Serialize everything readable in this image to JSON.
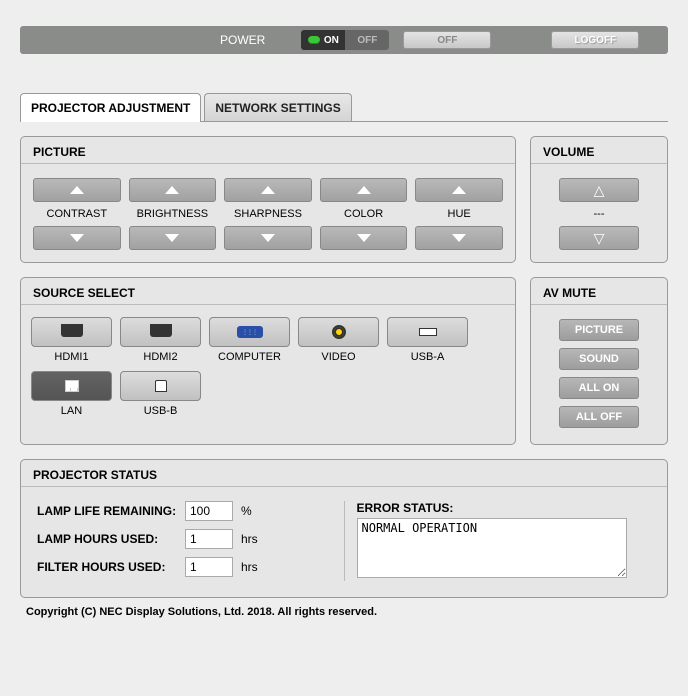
{
  "power_label": "POWER",
  "power": {
    "on": "ON",
    "off": "OFF"
  },
  "off_btn": "OFF",
  "logoff_btn": "LOGOFF",
  "tabs": {
    "adjustment": "PROJECTOR ADJUSTMENT",
    "network": "NETWORK SETTINGS"
  },
  "picture": {
    "title": "PICTURE",
    "items": [
      "CONTRAST",
      "BRIGHTNESS",
      "SHARPNESS",
      "COLOR",
      "HUE"
    ]
  },
  "volume": {
    "title": "VOLUME",
    "value": "---"
  },
  "source": {
    "title": "SOURCE SELECT",
    "items": [
      "HDMI1",
      "HDMI2",
      "COMPUTER",
      "VIDEO",
      "USB-A",
      "LAN",
      "USB-B"
    ],
    "selected": "LAN"
  },
  "avmute": {
    "title": "AV MUTE",
    "buttons": [
      "PICTURE",
      "SOUND",
      "ALL ON",
      "ALL OFF"
    ]
  },
  "status": {
    "title": "PROJECTOR STATUS",
    "lamp_life_label": "LAMP LIFE REMAINING:",
    "lamp_life_value": "100",
    "lamp_life_unit": "%",
    "lamp_hours_label": "LAMP HOURS USED:",
    "lamp_hours_value": "1",
    "lamp_hours_unit": "hrs",
    "filter_hours_label": "FILTER HOURS USED:",
    "filter_hours_value": "1",
    "filter_hours_unit": "hrs",
    "error_label": "ERROR STATUS:",
    "error_value": "NORMAL OPERATION"
  },
  "copyright": "Copyright (C) NEC Display Solutions, Ltd. 2018. All rights reserved."
}
